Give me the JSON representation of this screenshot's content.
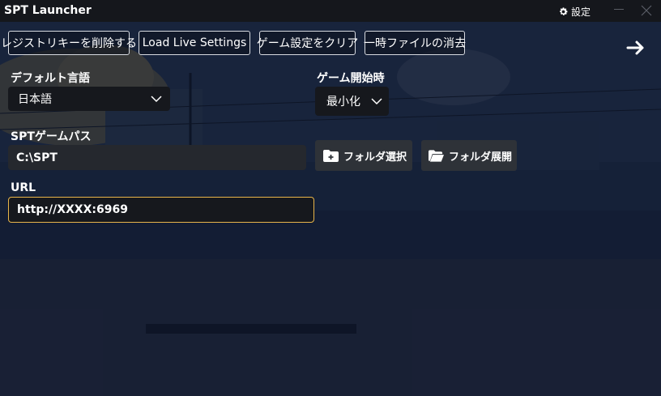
{
  "window": {
    "title": "SPT Launcher",
    "settings_label": "設定"
  },
  "toolbar": {
    "delete_registry": "レジストリキーを削除する",
    "load_live": "Load Live Settings",
    "clear_game_settings": "ゲーム設定をクリア",
    "clear_temp": "一時ファイルの消去"
  },
  "form": {
    "default_language_label": "デフォルト言語",
    "default_language_value": "日本語",
    "game_start_label": "ゲーム開始時",
    "game_start_value": "最小化",
    "game_path_label": "SPTゲームパス",
    "game_path_value": "C:\\SPT",
    "select_folder_label": "フォルダ選択",
    "open_folder_label": "フォルダ展開",
    "url_label": "URL",
    "url_value": "http://XXXX:6969"
  },
  "colors": {
    "accent_focus": "#e8b54a",
    "titlebar": "#15171c",
    "button_bg": "#2e3238"
  },
  "icons": [
    "gear-icon",
    "minimize-icon",
    "close-icon",
    "arrow-right-icon",
    "chevron-down-icon",
    "folder-add-icon",
    "folder-open-icon"
  ]
}
